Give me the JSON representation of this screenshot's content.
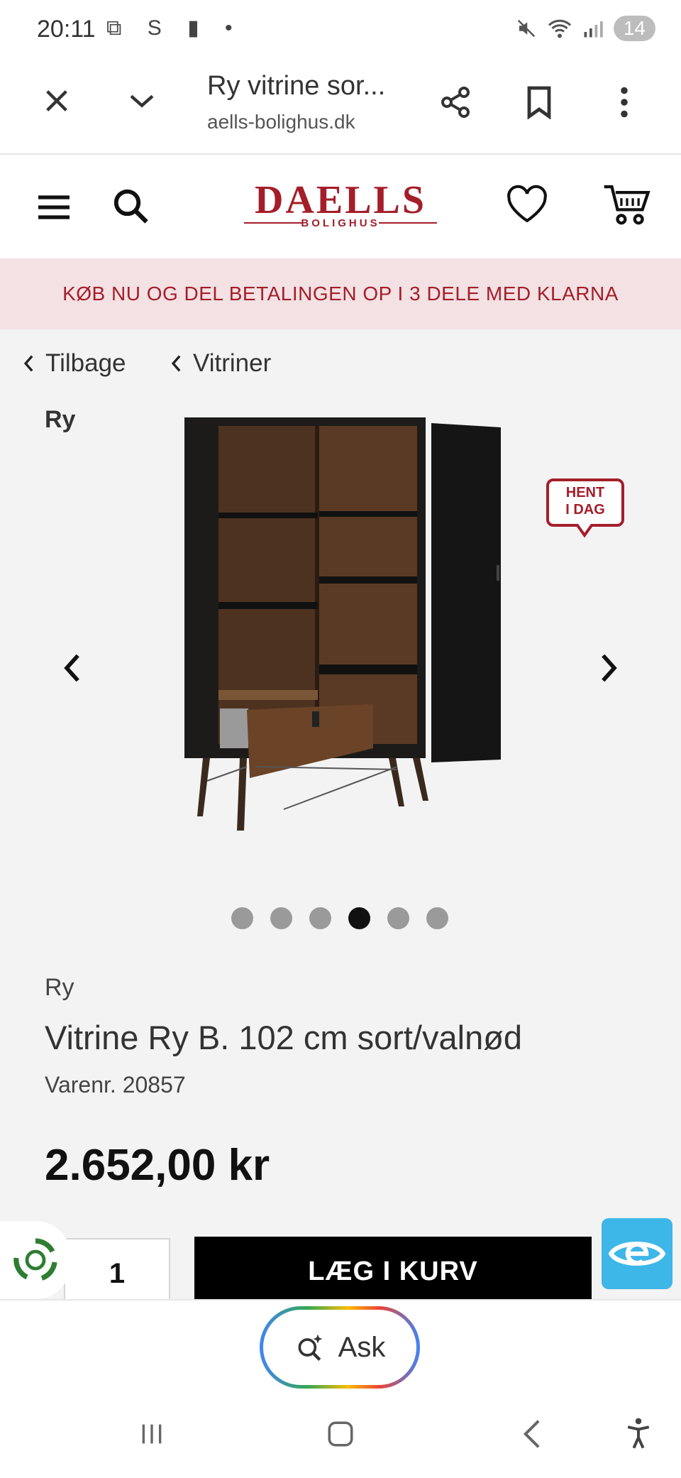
{
  "status_bar": {
    "time": "20:11",
    "left_icons": "⧉ S ▮ •",
    "battery": "14"
  },
  "browser": {
    "page_title": "Ry vitrine sor...",
    "url": "aells-bolighus.dk"
  },
  "site": {
    "logo_main": "DAELLS",
    "logo_sub": "BOLIGHUS",
    "promo": "KØB NU OG DEL BETALINGEN OP I 3 DELE MED KLARNA"
  },
  "breadcrumbs": {
    "back": "Tilbage",
    "category": "Vitriner"
  },
  "gallery": {
    "brand_tag": "Ry",
    "badge_line1": "HENT",
    "badge_line2": "I DAG",
    "dot_count": 6,
    "active_index": 3
  },
  "product": {
    "brand": "Ry",
    "title": "Vitrine Ry B. 102 cm sort/valnød",
    "sku": "Varenr. 20857",
    "price": "2.652,00 kr",
    "quantity": "1",
    "add_to_cart": "LÆG I KURV"
  },
  "assistant": {
    "label": "Ask"
  },
  "colors": {
    "brand": "#a41e2a",
    "promo_bg": "#f3e1e3",
    "accent_eye": "#3db6e8"
  }
}
